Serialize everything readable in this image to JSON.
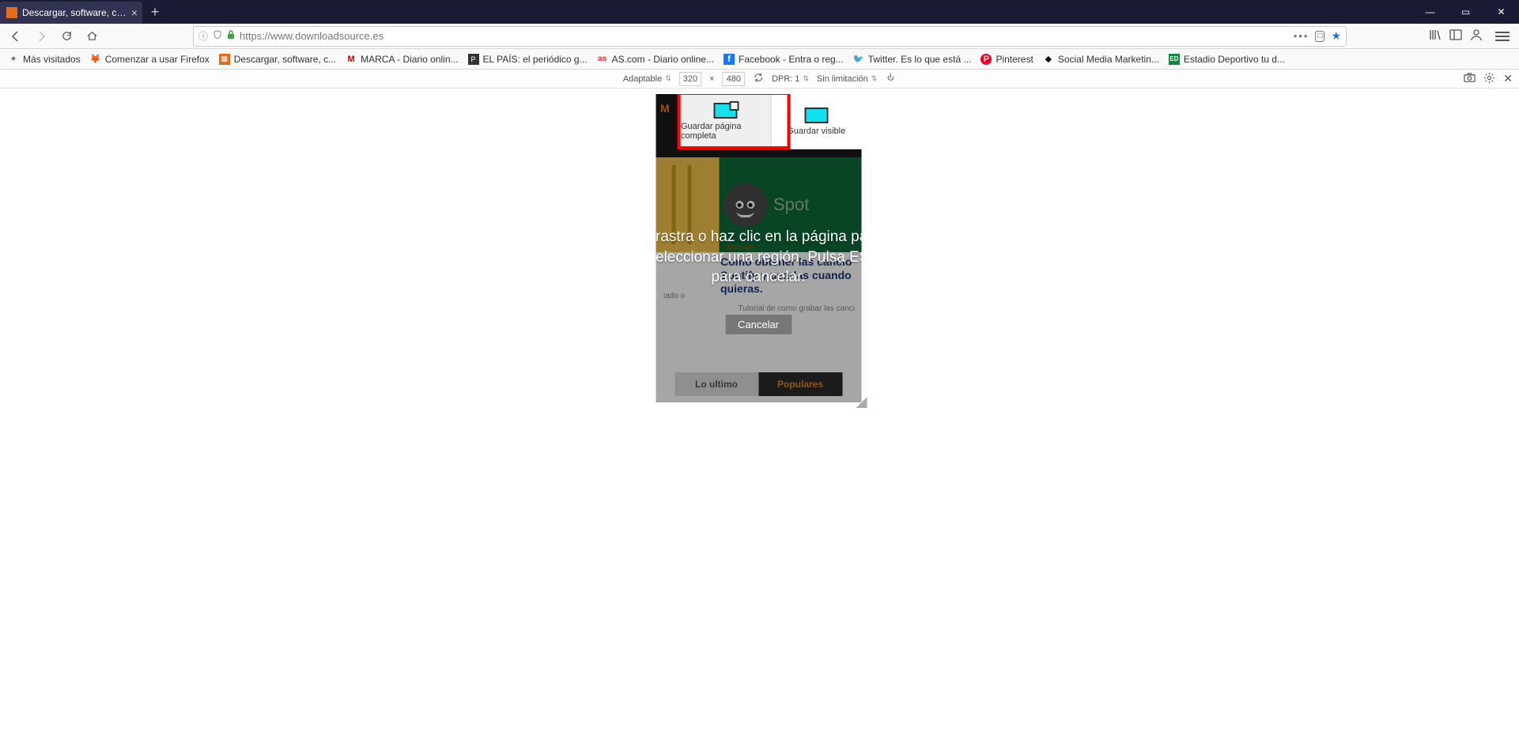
{
  "window": {
    "tab_title": "Descargar, software, controlad…"
  },
  "url_bar": {
    "url": "https://www.downloadsource.es"
  },
  "bookmarks": [
    {
      "label": "Más visitados",
      "icon": "✦",
      "color": "#6a6a6a"
    },
    {
      "label": "Comenzar a usar Firefox",
      "icon": "🦊",
      "color": "#ff8a00"
    },
    {
      "label": "Descargar, software, c...",
      "icon": "▦",
      "color": "#e26b1e"
    },
    {
      "label": "MARCA - Diario onlin...",
      "icon": "M",
      "color": "#c00"
    },
    {
      "label": "EL PAÍS: el periódico g...",
      "icon": "P",
      "color": "#333"
    },
    {
      "label": "AS.com - Diario online...",
      "icon": "as",
      "color": "#d33"
    },
    {
      "label": "Facebook - Entra o reg...",
      "icon": "f",
      "color": "#1877f2"
    },
    {
      "label": "Twitter. Es lo que está ...",
      "icon": "🐦",
      "color": "#1da1f2"
    },
    {
      "label": "Pinterest",
      "icon": "P",
      "color": "#e60023"
    },
    {
      "label": "Social Media Marketin...",
      "icon": "◆",
      "color": "#111"
    },
    {
      "label": "Estadio Deportivo tu d...",
      "icon": "ED",
      "color": "#0a8a3a"
    }
  ],
  "rdm": {
    "device": "Adaptable",
    "width": "320",
    "height": "480",
    "dpr_label": "DPR: 1",
    "throttle": "Sin limitación"
  },
  "screenshot_popup": {
    "full": "Guardar página completa",
    "visible": "Guardar visible",
    "instruction": "rastra o haz clic en la página pa eleccionar una región. Pulsa ES para cancelar.",
    "instr_line1": "rastra o haz clic en la página pa",
    "instr_line2": "eleccionar una región. Pulsa ES",
    "instr_line3": "para cancelar.",
    "cancel": "Cancelar"
  },
  "page": {
    "brand": "M",
    "crumb": "Noticias",
    "spot_text": "Spot",
    "story_title": "Como obtener las cancio Spotify y usarlas cuando quieras.",
    "story_sub": "Tutorial de como grabar las canci",
    "left_tiny": "iado o",
    "section": "Noticias",
    "tab_lo": "Lo ultimo",
    "tab_pop": "Populares"
  }
}
